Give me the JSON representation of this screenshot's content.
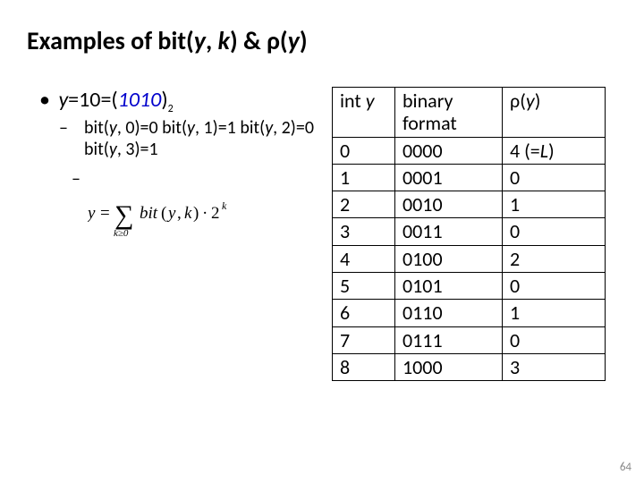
{
  "title_parts": {
    "p1": "Examples of bit(",
    "y1": "y",
    "p2": ", ",
    "k": "k",
    "p3": ") & ρ(",
    "y2": "y",
    "p4": ")"
  },
  "bullet1": {
    "y": "y",
    "eq": "=10=(",
    "bin": "1010",
    "close": ")",
    "sub": "2"
  },
  "bullet2": {
    "line1a": "bit(",
    "y0": "y",
    "line1b": ", 0)=0 bit(",
    "y1": "y",
    "line1c": ", 1)=1",
    "line2a": "bit(",
    "y2": "y",
    "line2b": ", 2)=0 bit(",
    "y3": "y",
    "line2c": ", 3)=1"
  },
  "formula": {
    "y": "y",
    "eq": "=",
    "sum_lower": "k≥0",
    "bit": "bit",
    "open": "(",
    "yv": "y",
    "comma": ",",
    "kv": "k",
    "close": ")",
    "dot": "·",
    "two": "2",
    "exp": "k"
  },
  "table": {
    "headers": {
      "int_label_pre": "int ",
      "int_y": "y",
      "bin": "binary format",
      "rho_pre": "ρ(",
      "rho_y": "y",
      "rho_post": ")"
    },
    "rows": [
      {
        "int": "0",
        "bin": "0000",
        "rho": "4 (=",
        "rho_it": "L",
        "rho_post": ")"
      },
      {
        "int": "1",
        "bin": "0001",
        "rho": "0"
      },
      {
        "int": "2",
        "bin": "0010",
        "rho": "1"
      },
      {
        "int": "3",
        "bin": "0011",
        "rho": "0"
      },
      {
        "int": "4",
        "bin": "0100",
        "rho": "2"
      },
      {
        "int": "5",
        "bin": "0101",
        "rho": "0"
      },
      {
        "int": "6",
        "bin": "0110",
        "rho": "1"
      },
      {
        "int": "7",
        "bin": "0111",
        "rho": "0"
      },
      {
        "int": "8",
        "bin": "1000",
        "rho": "3"
      }
    ]
  },
  "page_number": "64"
}
